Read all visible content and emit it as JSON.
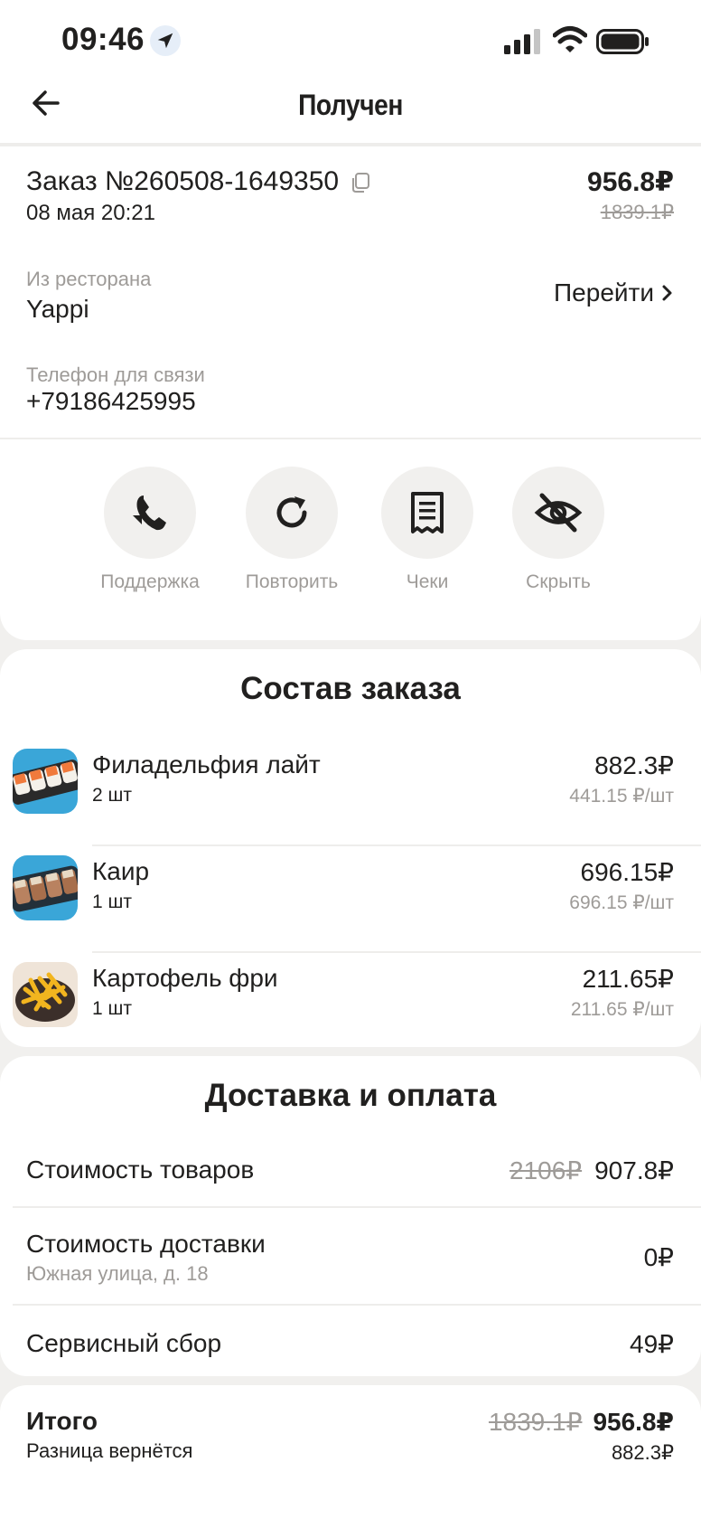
{
  "status_bar": {
    "time": "09:46"
  },
  "header": {
    "title": "Получен"
  },
  "order": {
    "number": "Заказ №260508-1649350",
    "date": "08 мая 20:21",
    "total": "956.8₽",
    "total_old": "1839.1₽",
    "restaurant_label": "Из ресторана",
    "restaurant_name": "Yappi",
    "goto_label": "Перейти",
    "phone_label": "Телефон для связи",
    "phone": "+79186425995"
  },
  "actions": [
    {
      "label": "Поддержка",
      "icon": "support-chat-icon"
    },
    {
      "label": "Повторить",
      "icon": "repeat-icon"
    },
    {
      "label": "Чеки",
      "icon": "receipt-icon"
    },
    {
      "label": "Скрыть",
      "icon": "hide-eye-icon"
    }
  ],
  "composition": {
    "title": "Состав заказа",
    "items": [
      {
        "name": "Филадельфия лайт",
        "qty": "2 шт",
        "price": "882.3₽",
        "unit_price": "441.15 ₽/шт"
      },
      {
        "name": "Каир",
        "qty": "1 шт",
        "price": "696.15₽",
        "unit_price": "696.15 ₽/шт"
      },
      {
        "name": "Картофель фри",
        "qty": "1 шт",
        "price": "211.65₽",
        "unit_price": "211.65 ₽/шт"
      }
    ]
  },
  "delivery": {
    "title": "Доставка и оплата",
    "goods_label": "Стоимость товаров",
    "goods_old": "2106₽",
    "goods_value": "907.8₽",
    "delivery_label": "Стоимость доставки",
    "delivery_address": "Южная улица, д. 18",
    "delivery_value": "0₽",
    "service_label": "Сервисный сбор",
    "service_value": "49₽"
  },
  "total": {
    "label": "Итого",
    "sub": "Разница вернётся",
    "old": "1839.1₽",
    "value": "956.8₽",
    "refund": "882.3₽"
  },
  "colors": {
    "muted": "#9e9b98",
    "text": "#21201f",
    "surface": "#f1f0ee"
  }
}
